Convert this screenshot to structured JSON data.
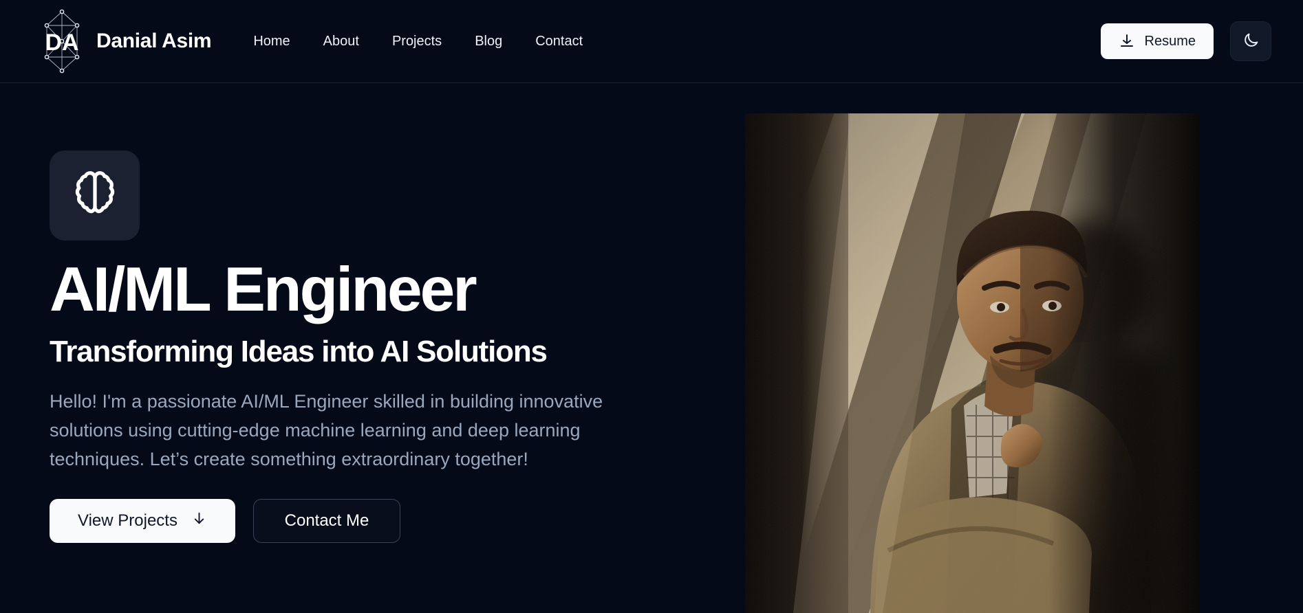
{
  "header": {
    "logo_icon": "da-monogram-network-logo",
    "brand_name": "Danial Asim",
    "nav": [
      {
        "label": "Home",
        "name": "nav-link-home"
      },
      {
        "label": "About",
        "name": "nav-link-about"
      },
      {
        "label": "Projects",
        "name": "nav-link-projects"
      },
      {
        "label": "Blog",
        "name": "nav-link-blog"
      },
      {
        "label": "Contact",
        "name": "nav-link-contact"
      }
    ],
    "resume_label": "Resume",
    "resume_icon": "download-icon",
    "theme_toggle_icon": "moon-icon"
  },
  "hero": {
    "badge_icon": "brain-icon",
    "title": "AI/ML Engineer",
    "subtitle": "Transforming Ideas into AI Solutions",
    "description": "Hello! I'm a passionate AI/ML Engineer skilled in building innovative solutions using cutting-edge machine learning and deep learning techniques. Let’s create something extraordinary together!",
    "primary_cta": "View Projects",
    "primary_cta_icon": "arrow-down-icon",
    "secondary_cta": "Contact Me",
    "portrait_alt": "Portrait of Danial Asim in a tweed blazer with dramatic window light"
  },
  "colors": {
    "background": "#050a18",
    "header_border": "#1b2536",
    "text_primary": "#ffffff",
    "text_muted": "#9aa8bd",
    "button_light": "#f8fafc",
    "button_light_text": "#0f172a",
    "badge_surface": "#1b2130",
    "outline_border": "#3a4456"
  }
}
